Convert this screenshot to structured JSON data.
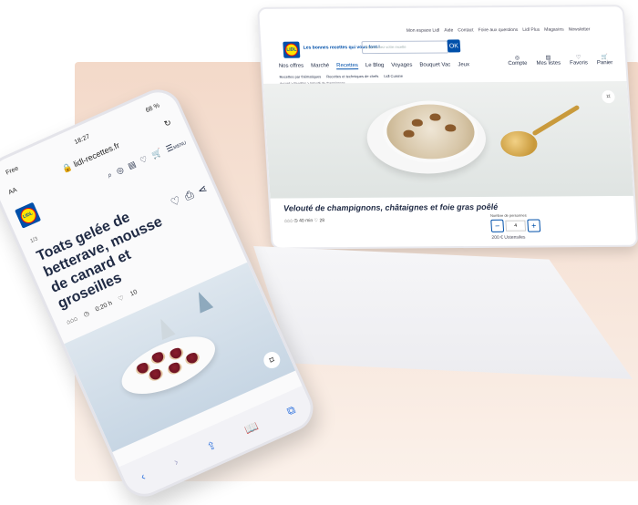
{
  "laptop": {
    "header": {
      "logo_text": "LIDL",
      "tagline": "Les bonnes recettes qui vous font !",
      "search_placeholder": "Recherchez votre recette",
      "search_button": "OK",
      "top_links": [
        "Mon espace Lidl",
        "Aide",
        "Contact",
        "Foire aux questions",
        "Lidl Plus",
        "Magasins",
        "Newsletter"
      ],
      "nav": [
        "Nos offres",
        "Marché",
        "Recettes",
        "Le Blog",
        "Voyages",
        "Bouquet Vac",
        "Jeux"
      ],
      "nav_active": "Recettes",
      "nav_sub": [
        "Recettes par thématiques",
        "Recettes et techniques de chefs",
        "Lidl Cuisine"
      ],
      "breadcrumb": "Accueil > Recettes > Velouté de champignons",
      "icons": [
        {
          "icon": "account-icon",
          "label": "Compte"
        },
        {
          "icon": "list-icon",
          "label": "Mes listes"
        },
        {
          "icon": "favorites-icon",
          "label": "Favoris"
        },
        {
          "icon": "cart-icon",
          "label": "Panier"
        }
      ]
    },
    "recipe": {
      "title": "Velouté de champignons, châtaignes et foie gras poêlé",
      "meta_time": "40 min",
      "meta_likes": "28",
      "portions_label": "Nombre de personnes",
      "portions_value": "4",
      "footer_left": "200 €",
      "footer_right": "Ustensiles"
    }
  },
  "phone": {
    "status_time": "18:27",
    "status_left": "Free",
    "status_right": "68 %",
    "url": "lidl-recettes.fr",
    "text_size": "AA",
    "menu_label": "MENU",
    "count": "1/3",
    "title": "Toats gelée de betterave, mousse de canard et groseilles",
    "time": "0:20 h",
    "likes": "10",
    "bottom_icons": [
      "back-icon",
      "forward-icon",
      "share-icon",
      "bookmarks-icon",
      "tabs-icon"
    ]
  }
}
